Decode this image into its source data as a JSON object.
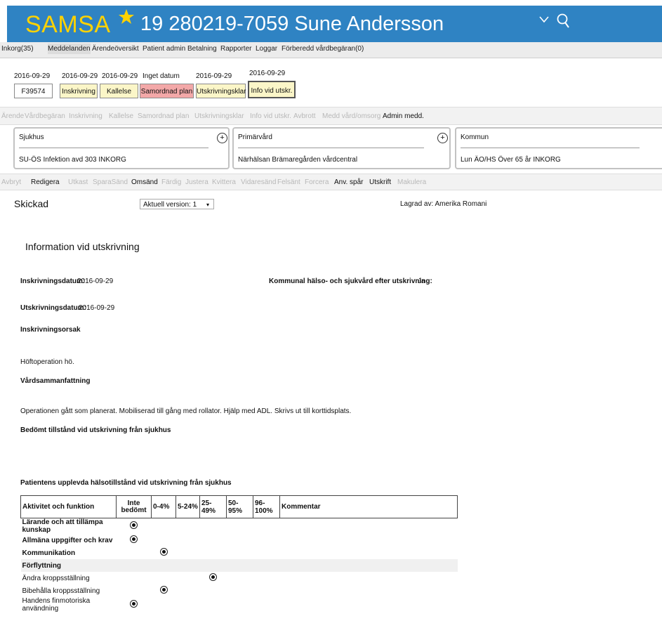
{
  "header": {
    "app_name": "SAMSA",
    "patient": "19 280219-7059 Sune Andersson",
    "brand_blue": "#2f83c3",
    "logo_yellow": "#ffd200",
    "icons": [
      "star-icon",
      "chevron-down-icon",
      "search-icon"
    ]
  },
  "menu": {
    "items": [
      "Inkorg(35)",
      "Meddelanden",
      "Ärendeöversikt",
      "Patient admin",
      "Betalning",
      "Rapporter",
      "Loggar",
      "Förberedd vårdbegäran(0)"
    ],
    "active": "Meddelanden"
  },
  "timeline": {
    "case_id": "F39574",
    "steps": [
      {
        "date": "2016-09-29",
        "label": "Inskrivning",
        "color": "#fbf6c8"
      },
      {
        "date": "2016-09-29",
        "label": "Kallelse",
        "color": "#fbf6c8"
      },
      {
        "date": "Inget datum",
        "label": "Samordnad plan",
        "color": "#f3a8a8"
      },
      {
        "date": "2016-09-29",
        "label": "Utskrivningsklar",
        "color": "#fbf6c8"
      },
      {
        "date": "2016-09-29",
        "label": "Info vid utskr.",
        "color": "#fbf6c8"
      }
    ],
    "first_date": "2016-09-29"
  },
  "nav_row": {
    "items": [
      "Ärende",
      "Vårdbegäran",
      "Inskrivning",
      "Kallelse",
      "Samordnad plan",
      "Utskrivningsklar",
      "Info vid utskr.",
      "Avbrott",
      "Medd vård/omsorg",
      "Admin medd."
    ]
  },
  "orgs": {
    "sjukhus": {
      "label": "Sjukhus",
      "value": "SU-ÖS Infektion avd 303 INKORG"
    },
    "primarvard": {
      "label": "Primärvård",
      "value": "Närhälsan Brämaregården vårdcentral"
    },
    "kommun": {
      "label": "Kommun",
      "value": "Lun ÄO/HS Över 65 år INKORG"
    }
  },
  "action_row": {
    "items": [
      "Avbryt",
      "Redigera",
      "Utkast",
      "SparaSänd",
      "Omsänd",
      "Färdig",
      "Justera",
      "Kvittera",
      "Vidaresänd",
      "Felsänt",
      "Forcera",
      "Anv. spår",
      "Utskrift",
      "Makulera"
    ]
  },
  "status": {
    "title": "Skickad",
    "version": "Aktuell version: 1",
    "saved_by": "Lagrad av: Amerika Romani"
  },
  "document": {
    "heading": "Information vid utskrivning",
    "inskrivningsdatum_label": "Inskrivningsdatum:",
    "inskrivningsdatum": "2016-09-29",
    "kommunal_label": "Kommunal hälso- och sjukvård efter utskrivning:",
    "kommunal_value": "Ja",
    "utskrivningsdatum_label": "Utskrivningsdatum:",
    "utskrivningsdatum": "2016-09-29",
    "orsak_label": "Inskrivningsorsak",
    "orsak": "Höftoperation hö.",
    "sammanfattning_label": "Vårdsammanfattning",
    "sammanfattning": "Operationen gått som planerat. Mobiliserad till gång med rollator. Hjälp med ADL. Skrivs ut till korttidsplats.",
    "bedomt_label": "Bedömt tillstånd vid utskrivning från sjukhus",
    "upplevda_label": "Patientens upplevda hälsotillstånd vid utskrivning från sjukhus"
  },
  "function_table": {
    "headers": [
      "Aktivitet och funktion",
      "Inte bedömt",
      "0-4%",
      "5-24%",
      "25-49%",
      "50-95%",
      "96-100%",
      "Kommentar"
    ],
    "rows": [
      {
        "label": "Lärande och att tillämpa kunskap",
        "bold": true,
        "selected": 1
      },
      {
        "label": "Allmäna uppgifter och krav",
        "bold": true,
        "selected": 1
      },
      {
        "label": "Kommunikation",
        "bold": true,
        "selected": 2
      },
      {
        "label": "Förflyttning",
        "bold": true,
        "selected": 0,
        "group": true
      },
      {
        "label": "Ändra kroppsställning",
        "bold": false,
        "selected": 4
      },
      {
        "label": "Bibehålla kroppsställning",
        "bold": false,
        "selected": 2
      },
      {
        "label": "Handens finmotoriska användning",
        "bold": false,
        "selected": 1
      }
    ]
  }
}
